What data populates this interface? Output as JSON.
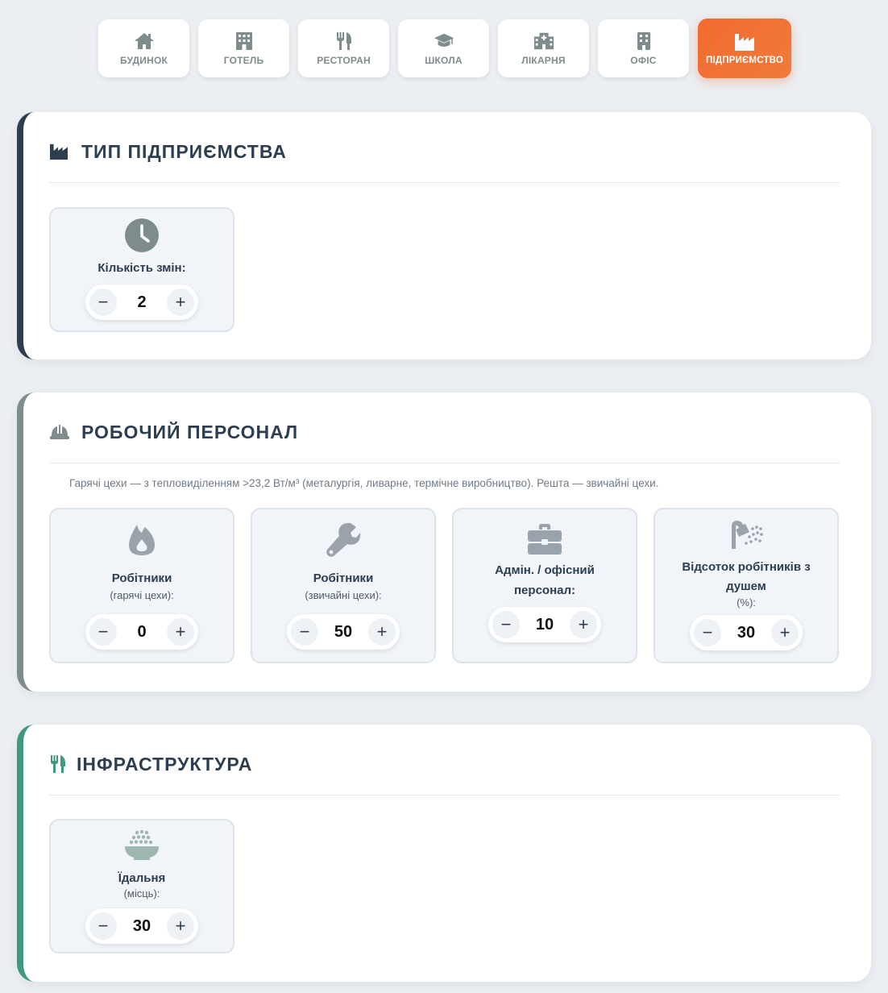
{
  "tabs": [
    {
      "label": "БУДИНОК",
      "icon": "house-icon",
      "active": false
    },
    {
      "label": "ГОТЕЛЬ",
      "icon": "hotel-icon",
      "active": false
    },
    {
      "label": "РЕСТОРАН",
      "icon": "utensils-icon",
      "active": false
    },
    {
      "label": "ШКОЛА",
      "icon": "graduation-cap-icon",
      "active": false
    },
    {
      "label": "ЛІКАРНЯ",
      "icon": "hospital-icon",
      "active": false
    },
    {
      "label": "ОФІС",
      "icon": "office-building-icon",
      "active": false
    },
    {
      "label": "ПІДПРИЄМСТВО",
      "icon": "factory-icon",
      "active": true
    }
  ],
  "colors": {
    "accent": "#f26a2e",
    "dark": "#2c3e50",
    "grey": "#7f8c8d",
    "green": "#3d9a80"
  },
  "enterprise": {
    "title": "ТИП ПІДПРИЄМСТВА",
    "icon": "factory-icon",
    "shifts": {
      "label": "Кількість змін:",
      "value": "2",
      "icon": "clock-icon"
    }
  },
  "staff": {
    "title": "РОБОЧИЙ ПЕРСОНАЛ",
    "icon": "hard-hat-icon",
    "hint": "Гарячі цехи — з тепловиділенням >23,2 Вт/м³ (металургія, ливарне, термічне виробництво). Решта — звичайні цехи.",
    "hot": {
      "label": "Робітники",
      "sub": "(гарячі цехи):",
      "value": "0",
      "icon": "fire-icon"
    },
    "normal": {
      "label": "Робітники",
      "sub": "(звичайні цехи):",
      "value": "50",
      "icon": "wrench-icon"
    },
    "admin": {
      "label_line1": "Адмін. / офісний",
      "label_line2": "персонал:",
      "value": "10",
      "icon": "briefcase-icon"
    },
    "shower": {
      "label_line1": "Відсоток робітників з",
      "label_line2": "душем",
      "sub": "(%):",
      "value": "30",
      "icon": "shower-icon"
    }
  },
  "infrastructure": {
    "title": "ІНФРАСТРУКТУРА",
    "icon": "utensils-icon",
    "canteen": {
      "label": "Їдальня",
      "sub": "(місць):",
      "value": "30",
      "icon": "bowl-rice-icon"
    }
  },
  "stepper": {
    "minus": "−",
    "plus": "+"
  }
}
